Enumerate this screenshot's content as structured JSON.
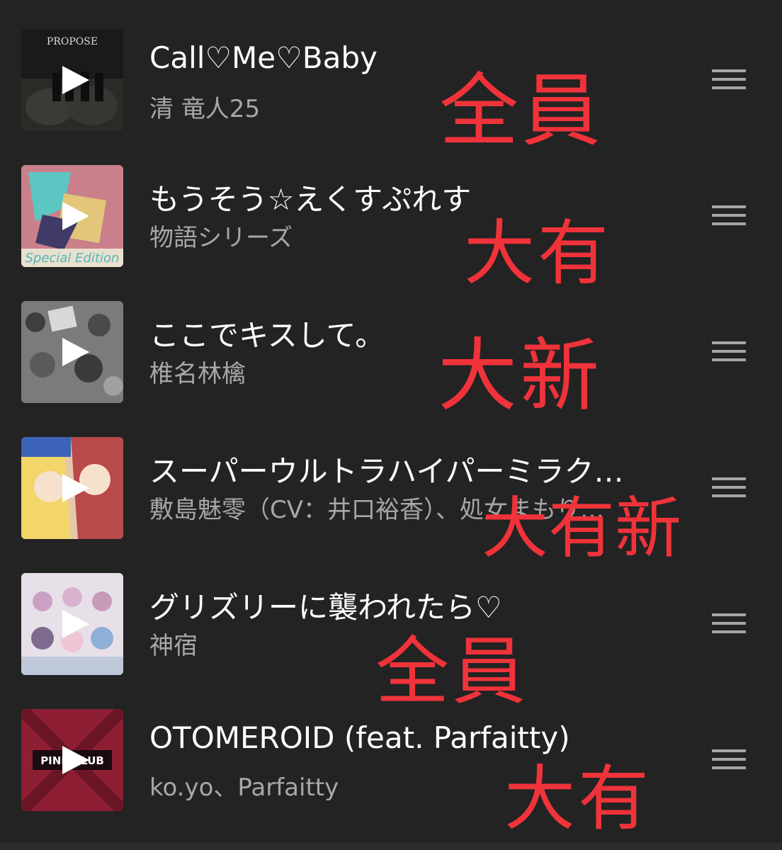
{
  "tracks": [
    {
      "title": "Call♡Me♡Baby",
      "artist": "清 竜人25",
      "cover_text": "PROPOSE"
    },
    {
      "title": "もうそう☆えくすぷれす",
      "artist": "物語シリーズ",
      "cover_text": "Special Edition"
    },
    {
      "title": "ここでキスして。",
      "artist": "椎名林檎",
      "cover_text": ""
    },
    {
      "title": "スーパーウルトラハイパーミラク…",
      "artist": "敷島魅零（CV：井口裕香）、処女まもり…",
      "cover_text": ""
    },
    {
      "title": "グリズリーに襲われたら♡",
      "artist": "神宿",
      "cover_text": ""
    },
    {
      "title": "OTOMEROID (feat. Parfaitty)",
      "artist": "ko.yo、Parfaitty",
      "cover_text": "PINK CLUB"
    }
  ],
  "annotations": [
    "全員",
    "大有",
    "大新",
    "大有新",
    "全員",
    "大有"
  ],
  "colors": {
    "background": "#232323",
    "title": "#ffffff",
    "artist": "#a7a7a7",
    "handle": "#a6a6a6",
    "annotation": "#f0333a"
  },
  "icons": {
    "play": "play-icon",
    "reorder": "drag-handle-icon"
  }
}
